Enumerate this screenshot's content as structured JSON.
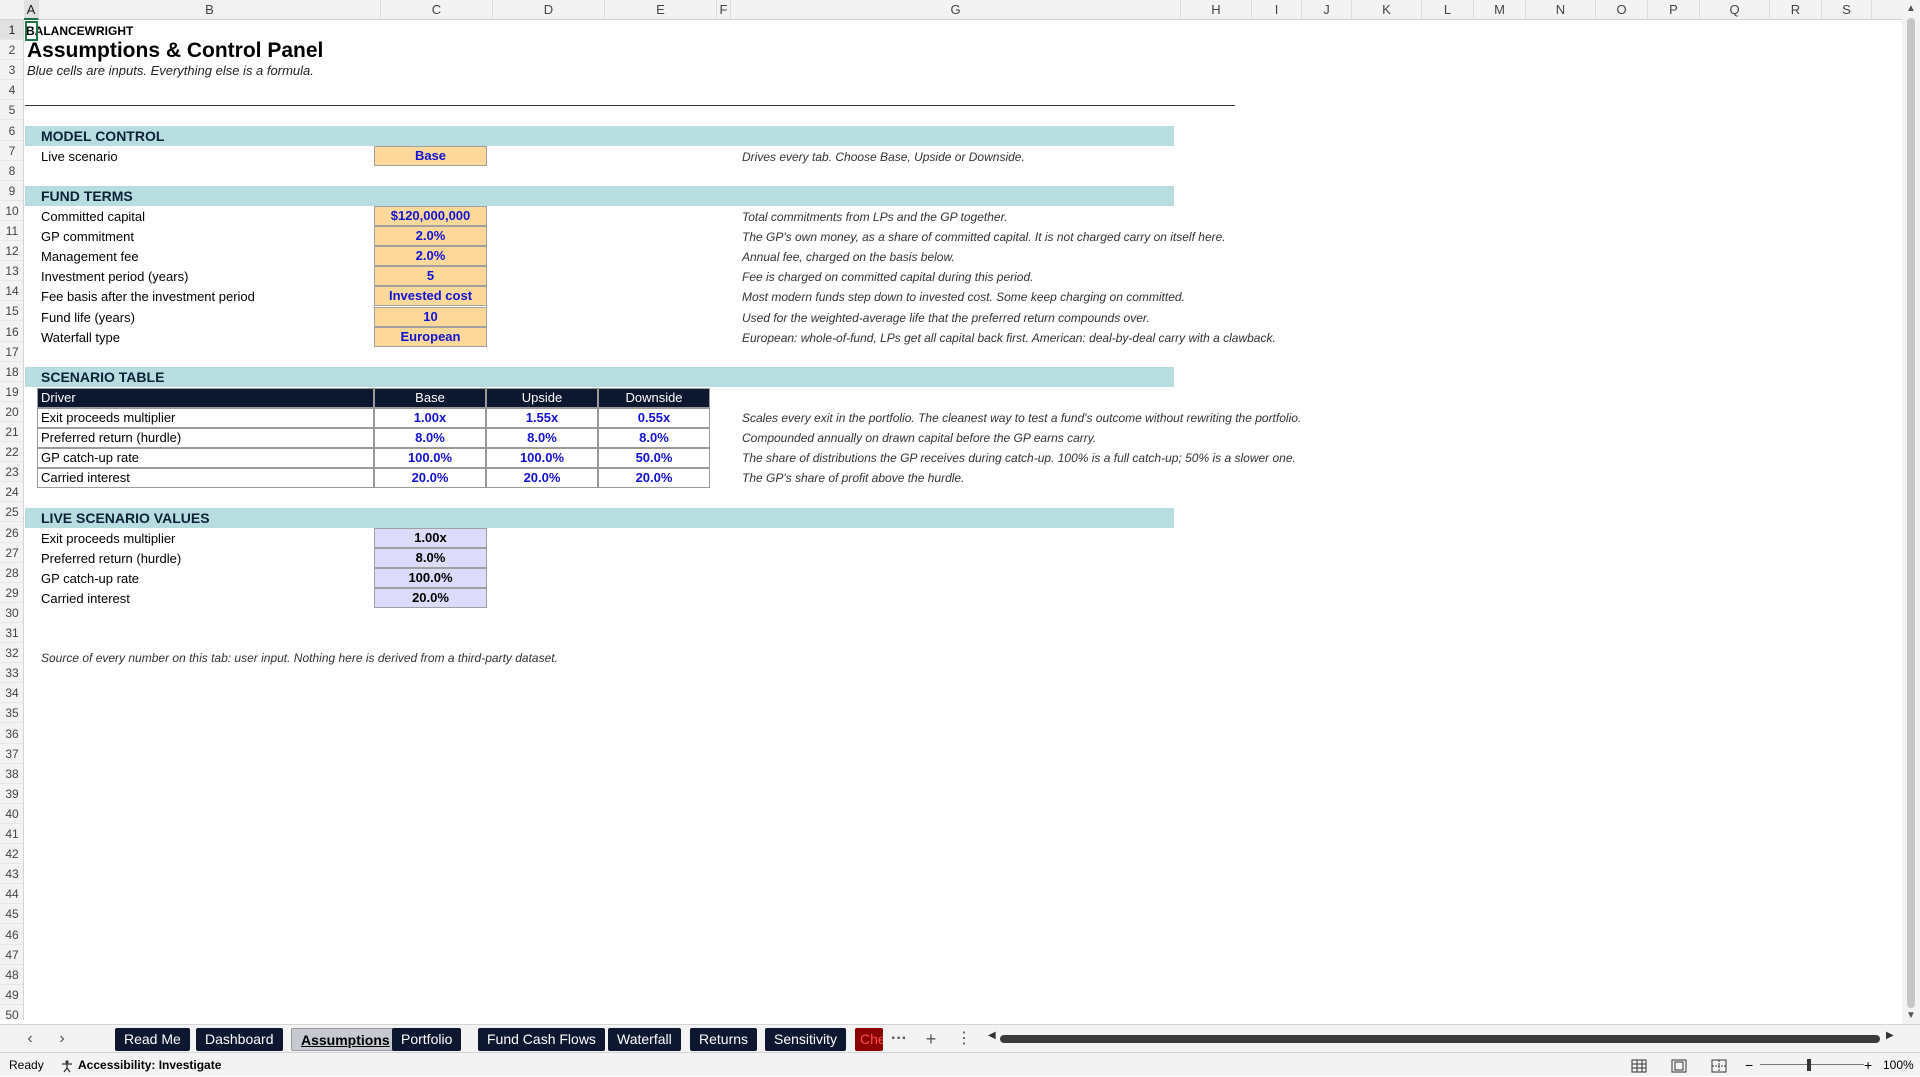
{
  "columns": [
    "A",
    "B",
    "C",
    "D",
    "E",
    "F",
    "G",
    "H",
    "I",
    "J",
    "K",
    "L",
    "M",
    "N",
    "O",
    "P",
    "Q",
    "R",
    "S"
  ],
  "rows": [
    "1",
    "2",
    "3",
    "4",
    "5",
    "6",
    "7",
    "8",
    "9",
    "10",
    "11",
    "12",
    "13",
    "14",
    "15",
    "16",
    "17",
    "18",
    "19",
    "20",
    "21",
    "22",
    "23",
    "24",
    "25",
    "26",
    "27",
    "28",
    "29",
    "30",
    "31",
    "32",
    "33",
    "34",
    "35",
    "36",
    "37",
    "38",
    "39",
    "40",
    "41",
    "42",
    "43",
    "44",
    "45",
    "46",
    "47",
    "48",
    "49",
    "50"
  ],
  "header": {
    "brand": "BALANCEWRIGHT",
    "title": "Assumptions & Control Panel",
    "subtitle": "Blue cells are inputs. Everything else is a formula."
  },
  "model_control": {
    "heading": "MODEL CONTROL",
    "label": "Live scenario",
    "value": "Base",
    "note": "Drives every tab. Choose Base, Upside or Downside."
  },
  "fund_terms": {
    "heading": "FUND TERMS",
    "items": [
      {
        "label": "Committed capital",
        "value": "$120,000,000",
        "note": "Total commitments from LPs and the GP together."
      },
      {
        "label": "GP commitment",
        "value": "2.0%",
        "note": "The GP's own money, as a share of committed capital. It is not charged carry on itself here."
      },
      {
        "label": "Management fee",
        "value": "2.0%",
        "note": "Annual fee, charged on the basis below."
      },
      {
        "label": "Investment period (years)",
        "value": "5",
        "note": "Fee is charged on committed capital during this period."
      },
      {
        "label": "Fee basis after the investment period",
        "value": "Invested cost",
        "note": "Most modern funds step down to invested cost. Some keep charging on committed."
      },
      {
        "label": "Fund life (years)",
        "value": "10",
        "note": "Used for the weighted-average life that the preferred return compounds over."
      },
      {
        "label": "Waterfall type",
        "value": "European",
        "note": "European: whole-of-fund, LPs get all capital back first. American: deal-by-deal carry with a clawback."
      }
    ]
  },
  "scenario_table": {
    "heading": "SCENARIO TABLE",
    "columns": [
      "Driver",
      "Base",
      "Upside",
      "Downside"
    ],
    "rows": [
      {
        "driver": "Exit proceeds multiplier",
        "base": "1.00x",
        "upside": "1.55x",
        "downside": "0.55x",
        "note": "Scales every exit in the portfolio. The cleanest way to test a fund's outcome without rewriting the portfolio."
      },
      {
        "driver": "Preferred return (hurdle)",
        "base": "8.0%",
        "upside": "8.0%",
        "downside": "8.0%",
        "note": "Compounded annually on drawn capital before the GP earns carry."
      },
      {
        "driver": "GP catch-up rate",
        "base": "100.0%",
        "upside": "100.0%",
        "downside": "50.0%",
        "note": "The share of distributions the GP receives during catch-up. 100% is a full catch-up; 50% is a slower one."
      },
      {
        "driver": "Carried interest",
        "base": "20.0%",
        "upside": "20.0%",
        "downside": "20.0%",
        "note": "The GP's share of profit above the hurdle."
      }
    ]
  },
  "live_values": {
    "heading": "LIVE SCENARIO VALUES",
    "items": [
      {
        "label": "Exit proceeds multiplier",
        "value": "1.00x"
      },
      {
        "label": "Preferred return (hurdle)",
        "value": "8.0%"
      },
      {
        "label": "GP catch-up rate",
        "value": "100.0%"
      },
      {
        "label": "Carried interest",
        "value": "20.0%"
      }
    ]
  },
  "source_note": "Source of every number on this tab: user input. Nothing here is derived from a third-party dataset.",
  "tabs": {
    "nav_prev": "‹",
    "nav_next": "›",
    "items": [
      "Read Me",
      "Dashboard",
      "Assumptions",
      "Portfolio",
      "Fund Cash Flows",
      "Waterfall",
      "Returns",
      "Sensitivity",
      "Che"
    ],
    "active": "Assumptions",
    "more": "···",
    "add": "+",
    "options": "⋮"
  },
  "status": {
    "ready": "Ready",
    "accessibility": "Accessibility: Investigate",
    "zoom": "100%"
  },
  "colors": {
    "section_band": "#b7dde0",
    "input_fill": "#fcd89a",
    "input_text": "#1111d6",
    "calc_fill": "#dcdcfa",
    "header_fill": "#0e1730"
  }
}
